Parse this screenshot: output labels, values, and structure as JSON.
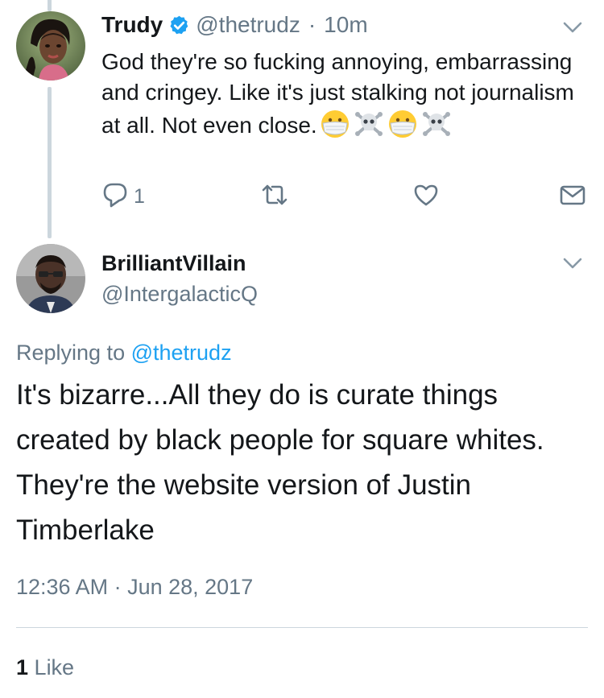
{
  "tweet1": {
    "display_name": "Trudy",
    "handle": "@thetrudz",
    "separator": "·",
    "time_ago": "10m",
    "text": "God they're so fucking annoying, embarrassing and cringey. Like it's just stalking not journalism at all. Not even close.",
    "emojis": [
      "face-with-medical-mask",
      "skull-and-crossbones",
      "face-with-medical-mask",
      "skull-and-crossbones"
    ],
    "reply_count": "1",
    "icons": {
      "verified": "verified-badge-icon",
      "menu": "chevron-down-icon",
      "reply": "reply-icon",
      "retweet": "retweet-icon",
      "like": "heart-icon",
      "dm": "envelope-icon"
    }
  },
  "tweet2": {
    "display_name": "BrilliantVillain",
    "handle": "@IntergalacticQ",
    "replying_prefix": "Replying to",
    "replying_to": "@thetrudz",
    "text": "It's bizarre...All they do is curate things created by black people for square whites. They're the website version of Justin Timberlake",
    "timestamp": "12:36 AM · Jun 28, 2017",
    "like_count": "1",
    "like_label": "Like",
    "icons": {
      "menu": "chevron-down-icon"
    }
  },
  "colors": {
    "text": "#14171a",
    "muted": "#657786",
    "link": "#1da1f2",
    "line": "#ccd6dd",
    "verified": "#1da1f2"
  }
}
